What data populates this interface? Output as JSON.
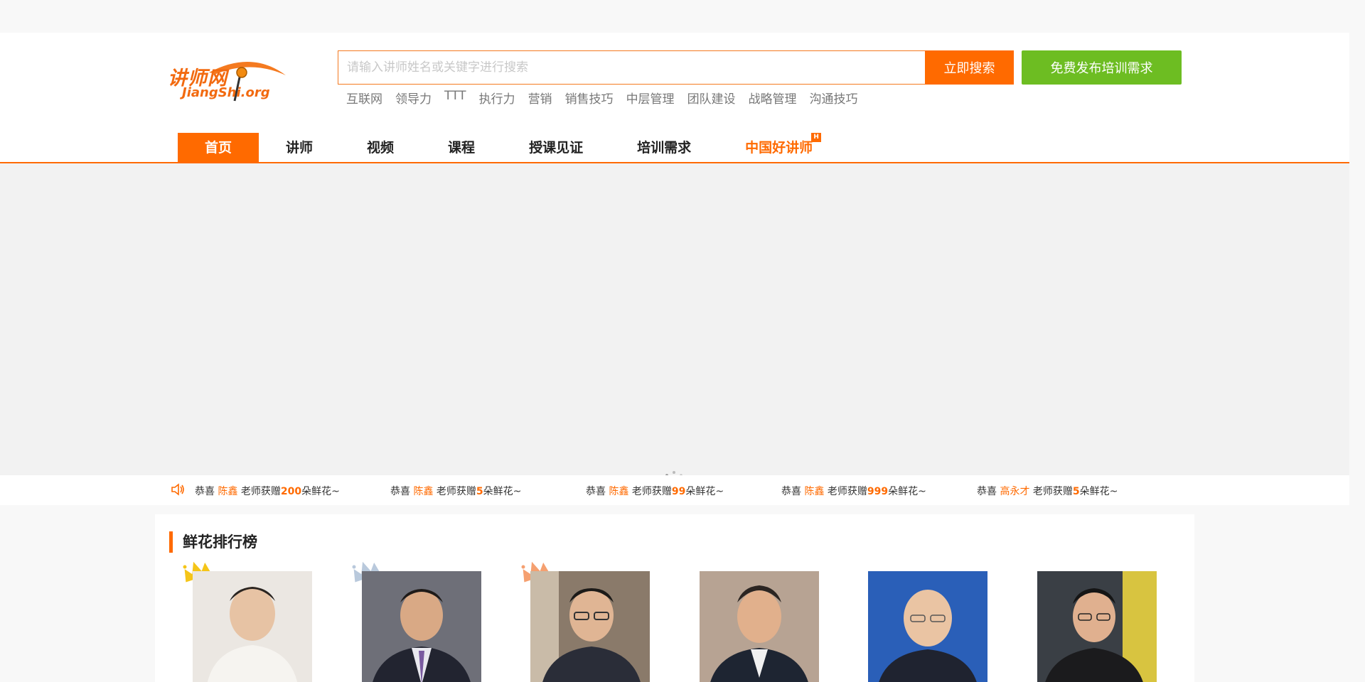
{
  "header": {
    "logo_cn": "讲师网",
    "logo_en": "JiangShi.org",
    "search_placeholder": "请输入讲师姓名或关键字进行搜索",
    "search_button": "立即搜索",
    "publish_button": "免费发布培训需求",
    "hotwords": [
      "互联网",
      "领导力",
      "TTT",
      "执行力",
      "营销",
      "销售技巧",
      "中层管理",
      "团队建设",
      "战略管理",
      "沟通技巧"
    ]
  },
  "nav": {
    "items": [
      {
        "label": "首页"
      },
      {
        "label": "讲师"
      },
      {
        "label": "视频"
      },
      {
        "label": "课程"
      },
      {
        "label": "授课见证"
      },
      {
        "label": "培训需求"
      },
      {
        "label": "中国好讲师"
      }
    ],
    "hot_badge": "H"
  },
  "banner": {
    "icon": "loading-spinner-icon"
  },
  "ticker": {
    "icon": "speaker-icon",
    "messages": [
      {
        "prefix": "恭喜 ",
        "name": "陈鑫",
        "middle": " 老师获赠",
        "count": "200",
        "suffix": "朵鲜花~"
      },
      {
        "prefix": "恭喜 ",
        "name": "陈鑫",
        "middle": " 老师获赠",
        "count": "5",
        "suffix": "朵鲜花~"
      },
      {
        "prefix": "恭喜 ",
        "name": "陈鑫",
        "middle": " 老师获赠",
        "count": "99",
        "suffix": "朵鲜花~"
      },
      {
        "prefix": "恭喜 ",
        "name": "陈鑫",
        "middle": " 老师获赠",
        "count": "999",
        "suffix": "朵鲜花~"
      },
      {
        "prefix": "恭喜 ",
        "name": "高永才",
        "middle": " 老师获赠",
        "count": "5",
        "suffix": "朵鲜花~"
      }
    ]
  },
  "ranking": {
    "title": "鲜花排行榜",
    "crown_colors": [
      "#f5c518",
      "#b9c9dc",
      "#f5a070"
    ],
    "photo_backgrounds": [
      "#e8e4df",
      "#6e6f78",
      "#8a7a6a",
      "#b7a393",
      "#2a5fb8",
      "#3a3f45"
    ]
  },
  "colors": {
    "accent": "#ff6a00",
    "green": "#6dbd22"
  }
}
